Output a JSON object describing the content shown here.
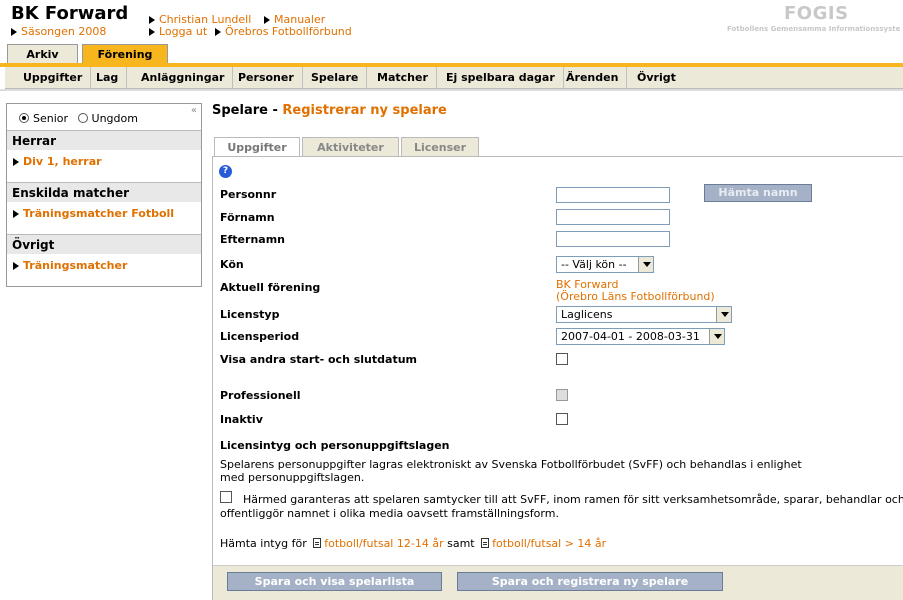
{
  "header": {
    "club_name": "BK Forward",
    "season": "Säsongen 2008",
    "links": {
      "user": "Christian Lundell",
      "manuals": "Manualer",
      "logout": "Logga ut",
      "federation": "Örebros Fotbollförbund"
    },
    "brand": "FOGIS",
    "brand_sub": "Fotbollens Gemensamma Informationssyste"
  },
  "top_tabs": {
    "archive": "Arkiv",
    "club": "Förening"
  },
  "menu": {
    "items": [
      "Uppgifter",
      "Lag",
      "Anläggningar",
      "Personer",
      "Spelare",
      "Matcher",
      "Ej spelbara dagar",
      "Ärenden",
      "Övrigt"
    ]
  },
  "sidebar": {
    "collapse": "«",
    "radio_senior": "Senior",
    "radio_youth": "Ungdom",
    "sections": [
      {
        "title": "Herrar",
        "link": "Div 1, herrar"
      },
      {
        "title": "Enskilda matcher",
        "link": "Träningsmatcher Fotboll"
      },
      {
        "title": "Övrigt",
        "link": "Träningsmatcher"
      }
    ]
  },
  "page": {
    "title": "Spelare",
    "separator": " - ",
    "subtitle": "Registrerar ny spelare"
  },
  "content_tabs": [
    "Uppgifter",
    "Aktiviteter",
    "Licenser"
  ],
  "form": {
    "help": "?",
    "personnr_label": "Personnr",
    "fetch_name_button": "Hämta namn",
    "firstname_label": "Förnamn",
    "lastname_label": "Efternamn",
    "gender_label": "Kön",
    "gender_value": "-- Välj kön --",
    "current_club_label": "Aktuell förening",
    "current_club_value": "BK Forward",
    "current_club_federation": "(Örebro Läns Fotbollförbund)",
    "license_type_label": "Licenstyp",
    "license_type_value": "Laglicens",
    "license_period_label": "Licensperiod",
    "license_period_value": "2007-04-01 - 2008-03-31",
    "other_dates_label": "Visa andra start- och slutdatum",
    "professional_label": "Professionell",
    "inactive_label": "Inaktiv"
  },
  "consent": {
    "heading": "Licensintyg och personuppgiftslagen",
    "paragraph_line1": "Spelarens personuppgifter lagras elektroniskt av Svenska Fotbollförbudet (SvFF) och behandlas i enlighet",
    "paragraph_line2": "med personuppgiftslagen.",
    "check_line1": "Härmed garanteras att spelaren samtycker till att SvFF, inom ramen för sitt verksamhetsområde, sparar, behandlar och",
    "check_line2": "offentliggör namnet i olika media oavsett framställningsform.",
    "fetch_prefix": "Hämta intyg för",
    "link1": "fotboll/futsal 12-14 år",
    "and": "samt",
    "link2": "fotboll/futsal > 14 år"
  },
  "actions": {
    "save_list": "Spara och visa spelarlista",
    "save_new": "Spara och registrera ny spelare"
  }
}
